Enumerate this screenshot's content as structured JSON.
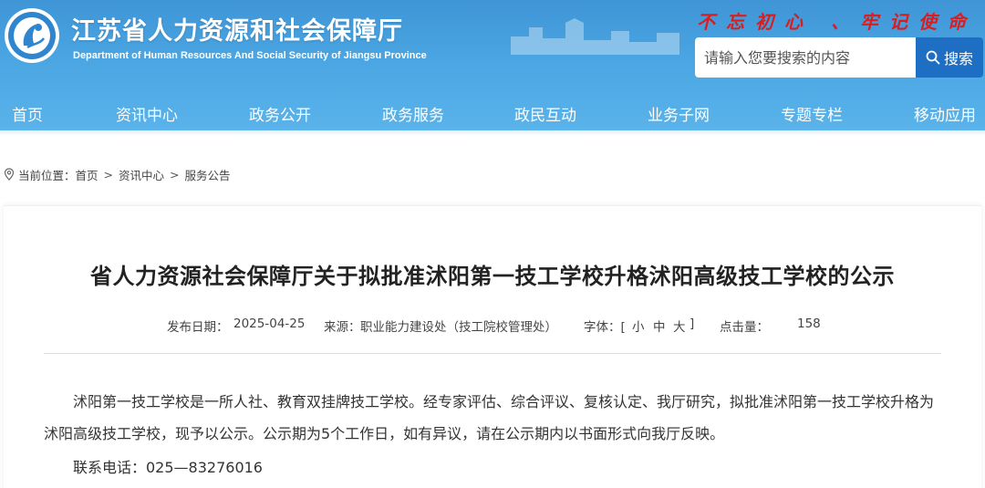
{
  "header": {
    "site_title": "江苏省人力资源和社会保障厅",
    "site_subtitle": "Department of Human Resources And Social Security of Jiangsu Province",
    "slogan": "不忘初心 、牢记使命",
    "search": {
      "placeholder": "请输入您要搜索的内容",
      "value": "",
      "button_label": "搜索"
    },
    "logo_icon": "hrss-jiangsu-emblem",
    "colors": {
      "header_blue": "#4aa5e2",
      "search_button": "#1e6fc4",
      "slogan_red": "#d81e1e"
    }
  },
  "nav": {
    "items": [
      {
        "label": "首页"
      },
      {
        "label": "资讯中心"
      },
      {
        "label": "政务公开"
      },
      {
        "label": "政务服务"
      },
      {
        "label": "政民互动"
      },
      {
        "label": "业务子网"
      },
      {
        "label": "专题专栏"
      },
      {
        "label": "移动应用"
      }
    ]
  },
  "breadcrumb": {
    "prefix": "当前位置：",
    "items": [
      "首页",
      "资讯中心",
      "服务公告"
    ],
    "separator": ">",
    "icon": "location-pin-icon"
  },
  "article": {
    "title": "省人力资源社会保障厅关于拟批准沭阳第一技工学校升格沭阳高级技工学校的公示",
    "meta": {
      "date_label": "发布日期：",
      "date": "2025-04-25",
      "source_label": "来源：",
      "source": "职业能力建设处（技工院校管理处）",
      "font_label": "字体：[",
      "font_small": "小",
      "font_medium": "中",
      "font_large": "大",
      "font_close": "]",
      "clicks_label": "点击量：",
      "clicks": "158"
    },
    "paragraphs": [
      "沭阳第一技工学校是一所人社、教育双挂牌技工学校。经专家评估、综合评议、复核认定、我厅研究，拟批准沭阳第一技工学校升格为沭阳高级技工学校，现予以公示。公示期为5个工作日，如有异议，请在公示期内以书面形式向我厅反映。",
      "联系电话：025—83276016"
    ]
  }
}
